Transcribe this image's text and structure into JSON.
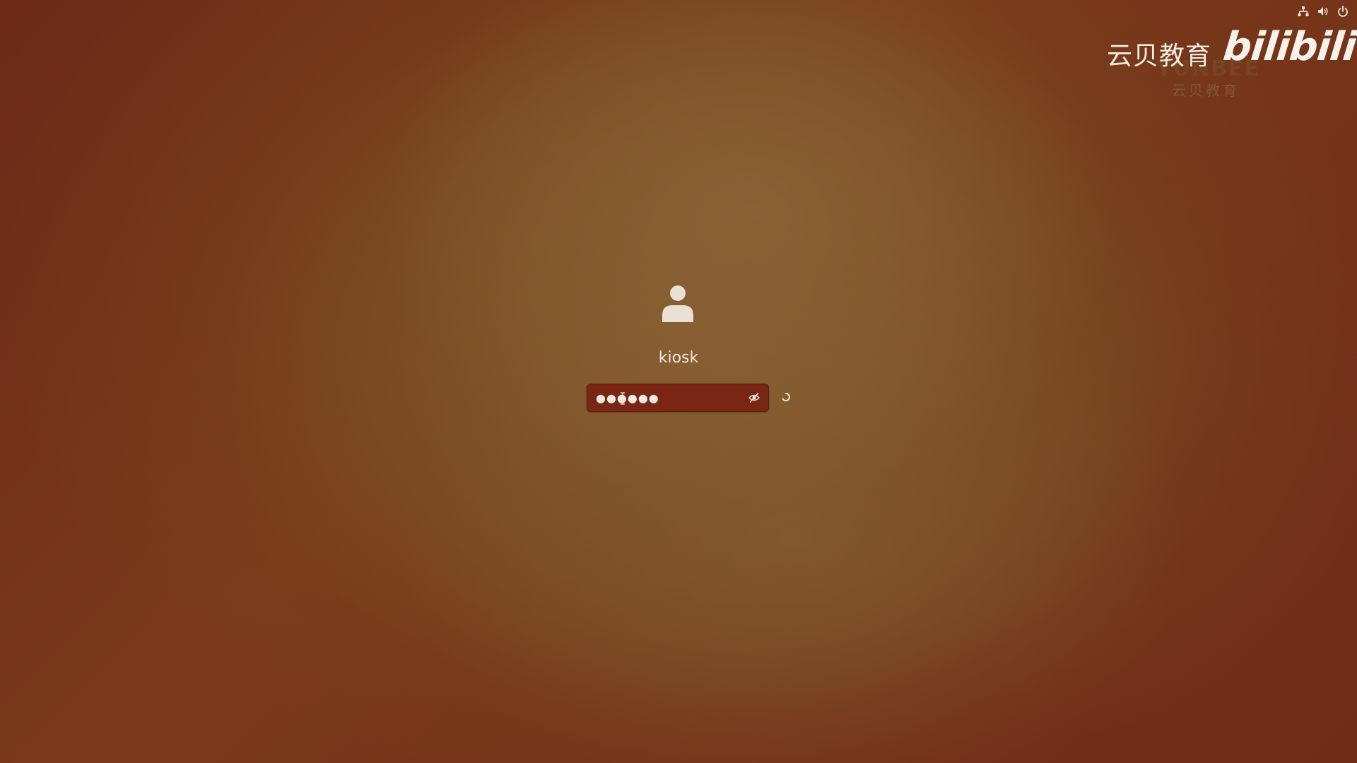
{
  "top_bar": {
    "icons": [
      "network-icon",
      "volume-icon",
      "power-icon"
    ]
  },
  "watermark": {
    "brand_cn": "云贝教育",
    "logo": "bilibili",
    "sub_en": "YUNBEE",
    "sub_cn": "云贝教育"
  },
  "login": {
    "username": "kiosk",
    "password_masked": "●●●●●●",
    "reveal_icon": "eye-hidden-icon",
    "status_icon": "spinner-icon"
  },
  "colors": {
    "background": "#6e2c18",
    "password_field": "#7a2614",
    "text": "#efe6dc"
  }
}
